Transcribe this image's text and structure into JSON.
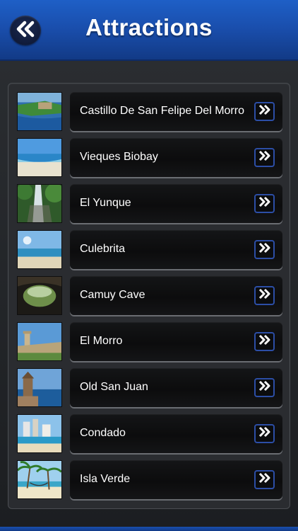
{
  "header": {
    "title": "Attractions",
    "back_icon": "double-chevron-left-icon"
  },
  "attractions": [
    {
      "label": "Castillo De San Felipe Del Morro",
      "thumb": "coastal-fort-photo"
    },
    {
      "label": "Vieques Biobay",
      "thumb": "beach-photo"
    },
    {
      "label": "El Yunque",
      "thumb": "waterfall-photo"
    },
    {
      "label": "Culebrita",
      "thumb": "beach-photo"
    },
    {
      "label": "Camuy Cave",
      "thumb": "cave-photo"
    },
    {
      "label": "El Morro",
      "thumb": "fort-photo"
    },
    {
      "label": "Old San Juan",
      "thumb": "sentry-box-photo"
    },
    {
      "label": "Condado",
      "thumb": "city-beach-photo"
    },
    {
      "label": "Isla Verde",
      "thumb": "palm-beach-photo"
    }
  ],
  "colors": {
    "header_blue": "#1a4fae",
    "arrow_border": "#2c4ea6",
    "background": "#1f2124"
  }
}
